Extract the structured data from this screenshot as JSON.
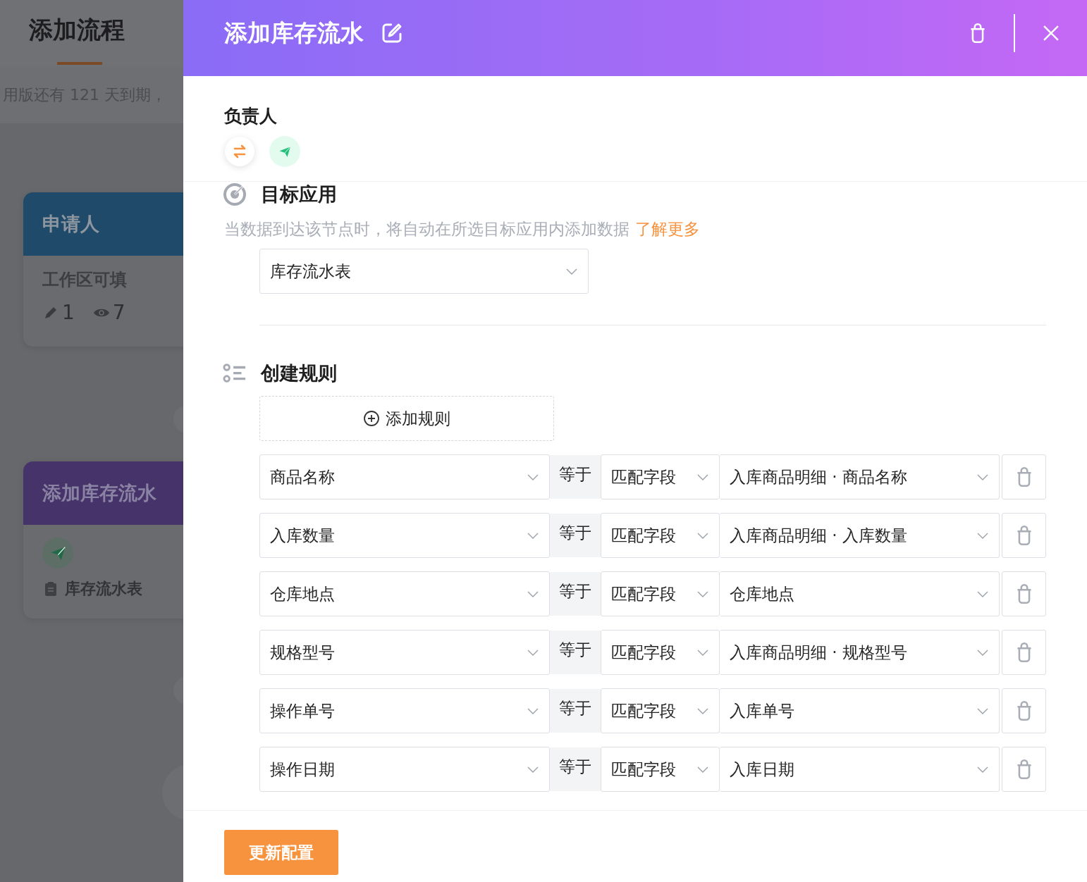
{
  "background_page": {
    "title": "添加流程",
    "notice": "用版还有 121 天到期，",
    "nodes": [
      {
        "kind": "applicant",
        "title": "申请人",
        "subtitle": "工作区可填",
        "edit_count": "1",
        "view_count": "7"
      },
      {
        "kind": "add_record",
        "title": "添加库存流水",
        "table": "库存流水表"
      }
    ]
  },
  "drawer": {
    "title": "添加库存流水",
    "owner": {
      "label": "负责人"
    },
    "target": {
      "title": "目标应用",
      "description": "当数据到达该节点时，将自动在所选目标应用内添加数据",
      "link": "了解更多",
      "app": "库存流水表"
    },
    "rules": {
      "title": "创建规则",
      "add_button": "添加规则",
      "rows": [
        {
          "field": "商品名称",
          "operator": "等于",
          "mode": "匹配字段",
          "value": "入库商品明细 · 商品名称"
        },
        {
          "field": "入库数量",
          "operator": "等于",
          "mode": "匹配字段",
          "value": "入库商品明细 · 入库数量"
        },
        {
          "field": "仓库地点",
          "operator": "等于",
          "mode": "匹配字段",
          "value": "仓库地点"
        },
        {
          "field": "规格型号",
          "operator": "等于",
          "mode": "匹配字段",
          "value": "入库商品明细 · 规格型号"
        },
        {
          "field": "操作单号",
          "operator": "等于",
          "mode": "匹配字段",
          "value": "入库单号"
        },
        {
          "field": "操作日期",
          "operator": "等于",
          "mode": "匹配字段",
          "value": "入库日期"
        }
      ]
    },
    "save_button": "更新配置"
  }
}
